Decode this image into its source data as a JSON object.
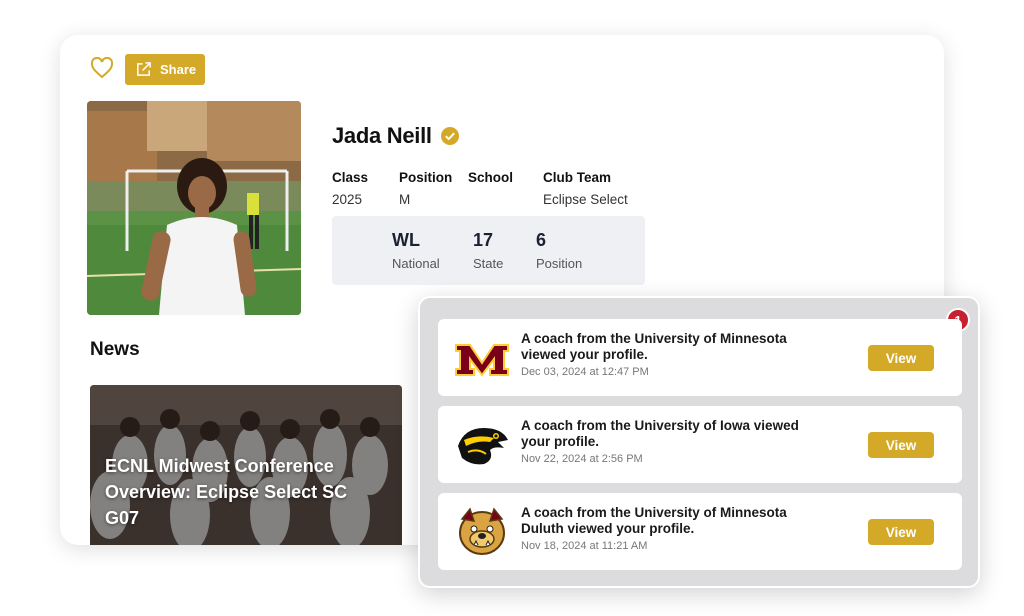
{
  "actions": {
    "share_label": "Share"
  },
  "colors": {
    "accent": "#d4a928",
    "badge": "#c62031",
    "stats_bg": "#eff0f3"
  },
  "profile": {
    "name": "Jada Neill",
    "verified": true,
    "fields": [
      {
        "label": "Class",
        "value": "2025"
      },
      {
        "label": "Position",
        "value": "M"
      },
      {
        "label": "School",
        "value": ""
      },
      {
        "label": "Club Team",
        "value": "Eclipse Select"
      }
    ],
    "stats": [
      {
        "value": "WL",
        "label": "National"
      },
      {
        "value": "17",
        "label": "State"
      },
      {
        "value": "6",
        "label": "Position"
      }
    ]
  },
  "news": {
    "heading": "News",
    "items": [
      {
        "title": "ECNL Midwest Conference Overview: Eclipse Select SC G07"
      }
    ]
  },
  "notifications": {
    "badge_count": "1",
    "items": [
      {
        "logo": "minnesota-m-logo",
        "message": "A coach from the University of Minnesota viewed your profile.",
        "date": "Dec 03, 2024 at 12:47 PM",
        "button": "View"
      },
      {
        "logo": "iowa-hawkeye-logo",
        "message": "A coach from the University of Iowa viewed your profile.",
        "date": "Nov 22, 2024 at 2:56 PM",
        "button": "View"
      },
      {
        "logo": "umd-bulldog-logo",
        "message": "A coach from the University of Minnesota Duluth viewed your profile.",
        "date": "Nov 18, 2024 at 11:21 AM",
        "button": "View"
      }
    ]
  }
}
